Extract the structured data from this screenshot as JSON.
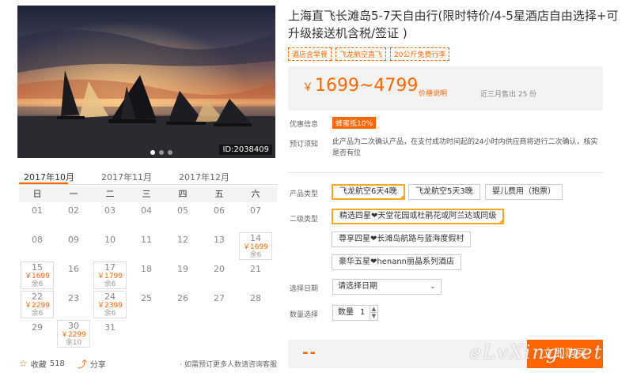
{
  "hero": {
    "id_label": "ID:2038409",
    "slide_count": 3,
    "active_slide": 0
  },
  "calendar": {
    "months": [
      "2017年10月",
      "2017年11月",
      "2017年12月"
    ],
    "weekdays": [
      "日",
      "一",
      "二",
      "三",
      "四",
      "五",
      "六"
    ],
    "rows": [
      [
        {
          "d": "01"
        },
        {
          "d": "02"
        },
        {
          "d": "03"
        },
        {
          "d": "04"
        },
        {
          "d": "05"
        },
        {
          "d": "06"
        },
        {
          "d": "07"
        }
      ],
      [
        {
          "d": "08"
        },
        {
          "d": "09"
        },
        {
          "d": "10"
        },
        {
          "d": "11"
        },
        {
          "d": "12"
        },
        {
          "d": "13"
        },
        {
          "d": "14",
          "p": "￥1699",
          "s": "余6"
        }
      ],
      [
        {
          "d": "15",
          "p": "￥1699",
          "s": "余6"
        },
        {
          "d": "16"
        },
        {
          "d": "17",
          "p": "￥1799",
          "s": "余6"
        },
        {
          "d": "18"
        },
        {
          "d": "19"
        },
        {
          "d": "20"
        },
        {
          "d": "21"
        }
      ],
      [
        {
          "d": "22",
          "p": "￥2299",
          "s": "余6"
        },
        {
          "d": "23"
        },
        {
          "d": "24",
          "p": "￥2399",
          "s": "余6"
        },
        {
          "d": "25"
        },
        {
          "d": "26"
        },
        {
          "d": "27"
        },
        {
          "d": "28"
        }
      ],
      [
        {
          "d": "29"
        },
        {
          "d": "30",
          "p": "￥2299",
          "s": "余10"
        },
        {
          "d": "31"
        },
        {
          "d": ""
        },
        {
          "d": ""
        },
        {
          "d": ""
        },
        {
          "d": ""
        }
      ]
    ]
  },
  "actions": {
    "favorite_label": "收藏",
    "favorite_count": "518",
    "share_label": "分享",
    "consult_text": "· 如需预订更多人数请咨询客服"
  },
  "product": {
    "title": "上海直飞长滩岛5-7天自由行(限时特价/4-5星酒店自由选择+可升级接送机含税/签证 )",
    "tags": [
      "酒店含早餐",
      "飞龙航空直飞",
      "20公斤免费行李"
    ],
    "price_range": "1699~4799",
    "currency": "￥",
    "price_note": "价格说明",
    "sold": "近三月售出 25 份",
    "promo_label": "优惠信息",
    "promo_badge": "蜂蜜抵10%",
    "notice_label": "预订须知",
    "notice_text": "此产品为二次确认产品，在支付成功时间起的24小时内供应商将进行二次确认，核实是否有位"
  },
  "options": {
    "type_label": "产品类型",
    "types": [
      "飞龙航空6天4晚",
      "飞龙航空5天3晚",
      "婴儿费用（抱票）"
    ],
    "sub_label": "二级类型",
    "subs": [
      "精选四星❤天堂花园或杜鹃花或阿兰达或同级",
      "尊享四星❤长滩岛航路与蓝海度假村",
      "豪华五星❤henann丽晶系列酒店"
    ],
    "date_label": "选择日期",
    "date_placeholder": "请选择日期",
    "qty_label": "数量选择",
    "qty_text": "数量",
    "qty_value": "1"
  },
  "buy": {
    "dash": "--",
    "button": "立即购买",
    "watermark": "eLvXing.net"
  },
  "colors": {
    "accent": "#ff6600",
    "selected_border": "#f9a825"
  }
}
